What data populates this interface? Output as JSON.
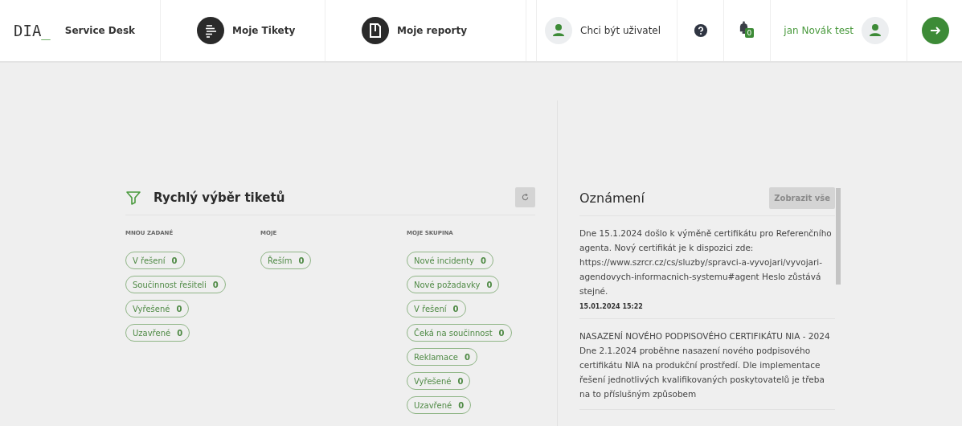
{
  "header": {
    "logo": "DIA",
    "logo_cursor": "_",
    "app_name": "Service Desk",
    "nav": [
      {
        "label": "Moje Tikety",
        "kind": "tickets"
      },
      {
        "label": "Moje reporty",
        "kind": "reports"
      }
    ],
    "become_user": "Chci být uživatel",
    "notifications_count": "0",
    "user_name": "jan Novák test"
  },
  "quick_filter": {
    "title": "Rychlý výběr tiketů",
    "columns": [
      {
        "heading": "MNOU ZADANÉ",
        "chips": [
          {
            "label": "V řešení",
            "count": "0"
          },
          {
            "label": "Součinnost řešiteli",
            "count": "0"
          },
          {
            "label": "Vyřešené",
            "count": "0"
          },
          {
            "label": "Uzavřené",
            "count": "0"
          }
        ]
      },
      {
        "heading": "MOJE",
        "chips": [
          {
            "label": "Řeším",
            "count": "0"
          }
        ]
      },
      {
        "heading": "MOJE SKUPINA",
        "chips": [
          {
            "label": "Nové incidenty",
            "count": "0"
          },
          {
            "label": "Nové požadavky",
            "count": "0"
          },
          {
            "label": "V řešení",
            "count": "0"
          },
          {
            "label": "Čeká na součinnost",
            "count": "0"
          },
          {
            "label": "Reklamace",
            "count": "0"
          },
          {
            "label": "Vyřešené",
            "count": "0"
          },
          {
            "label": "Uzavřené",
            "count": "0"
          }
        ]
      }
    ]
  },
  "announcements": {
    "title": "Oznámení",
    "button": "Zobrazit vše",
    "items": [
      {
        "text": "Dne 15.1.2024 došlo k výměně certifikátu pro Referenčního agenta. Nový certifikát je k dispozici zde: https://www.szrcr.cz/cs/sluzby/spravci-a-vyvojari/vyvojari-agendovych-informacnich-systemu#agent Heslo zůstává stejné.",
        "date": "15.01.2024 15:22"
      },
      {
        "text": "NASAZENÍ NOVÉHO PODPISOVÉHO CERTIFIKÁTU NIA - 2024 Dne 2.1.2024 proběhne nasazení nového podpisového certifikátu NIA na produkční prostředí. Dle implementace řešení jednotlivých kvalifikovaných poskytovatelů je třeba na to příslušným způsobem"
      }
    ]
  }
}
